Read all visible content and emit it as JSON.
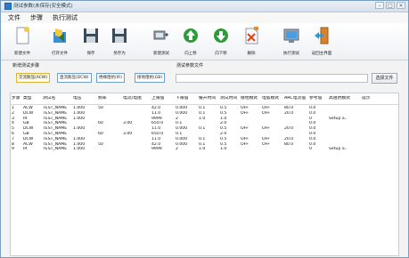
{
  "window": {
    "title": "测试参数(未保存|安全模式)",
    "controls": [
      "–",
      "□",
      "×"
    ]
  },
  "menu": [
    "文件",
    "步骤",
    "执行测试"
  ],
  "toolbar": [
    {
      "label": "新建文件",
      "icon": "new-file-icon"
    },
    {
      "label": "打开文件",
      "icon": "open-file-icon"
    },
    {
      "label": "保存",
      "icon": "save-icon"
    },
    {
      "label": "另存为",
      "icon": "save-as-icon"
    },
    {
      "label": "新建测试",
      "icon": "new-test-icon"
    },
    {
      "label": "向上移",
      "icon": "move-up-icon"
    },
    {
      "label": "向下移",
      "icon": "move-down-icon"
    },
    {
      "label": "删除",
      "icon": "delete-icon"
    },
    {
      "label": "执行测试",
      "icon": "run-test-icon"
    },
    {
      "label": "返回主界面",
      "icon": "exit-icon"
    }
  ],
  "panel": {
    "new_step_label": "新增测试步骤",
    "param_file_label": "测试参数文件",
    "param_file_value": "",
    "choose_file_label": "选择文件",
    "step_types": [
      "交流耐压(ACW)",
      "直流耐压(DCW)",
      "绝缘阻抗(IR)",
      "接地阻抗(GB)"
    ]
  },
  "table": {
    "columns": [
      "步骤",
      "类型",
      "测试名",
      "电压",
      "频率",
      "电流/电阻",
      "上限值",
      "下限值",
      "缓升时间",
      "测试时间",
      "接地模式",
      "电弧模式",
      "ARC电流值",
      "参考值",
      "高阻抗模式",
      "提示"
    ],
    "rows": [
      [
        "1",
        "ACW",
        "TEST_NAME",
        "1.000",
        "50",
        "",
        "42.0",
        "0.000",
        "0.1",
        "0.5",
        "OFF",
        "OFF",
        "80.0",
        "0.0",
        "",
        ""
      ],
      [
        "2",
        "DCW",
        "TEST_NAME",
        "1.000",
        "",
        "",
        "11.0",
        "0.000",
        "0.1",
        "0.5",
        "OFF",
        "OFF",
        "20.0",
        "0.0",
        "",
        ""
      ],
      [
        "3",
        "IR",
        "TEST_NAME",
        "1.000",
        "",
        "",
        "9999",
        "2",
        "1.0",
        "1.0",
        "",
        "",
        "",
        "0",
        "Setup a..",
        ""
      ],
      [
        "4",
        "GB",
        "TEST_NAME",
        "",
        "60",
        "3.00",
        "650.0",
        "0.1",
        "",
        "2.0",
        "",
        "",
        "",
        "0.0",
        "",
        ""
      ],
      [
        "5",
        "DCW",
        "TEST_NAME",
        "1.000",
        "",
        "",
        "11.0",
        "0.000",
        "0.1",
        "0.5",
        "OFF",
        "OFF",
        "20.0",
        "0.0",
        "",
        ""
      ],
      [
        "6",
        "GB",
        "TEST_NAME",
        "",
        "60",
        "3.00",
        "650.0",
        "0.1",
        "",
        "2.0",
        "",
        "",
        "",
        "0.0",
        "",
        ""
      ],
      [
        "7",
        "DCW",
        "TEST_NAME",
        "1.000",
        "",
        "",
        "11.0",
        "0.000",
        "0.1",
        "0.5",
        "OFF",
        "OFF",
        "20.0",
        "0.0",
        "",
        ""
      ],
      [
        "8",
        "ACW",
        "TEST_NAME",
        "1.000",
        "50",
        "",
        "42.0",
        "0.000",
        "0.1",
        "0.5",
        "OFF",
        "OFF",
        "80.0",
        "0.0",
        "",
        ""
      ],
      [
        "9",
        "IR",
        "TEST_NAME",
        "1.000",
        "",
        "",
        "9999",
        "2",
        "1.0",
        "1.0",
        "",
        "",
        "",
        "0",
        "Setup a..",
        ""
      ]
    ]
  }
}
